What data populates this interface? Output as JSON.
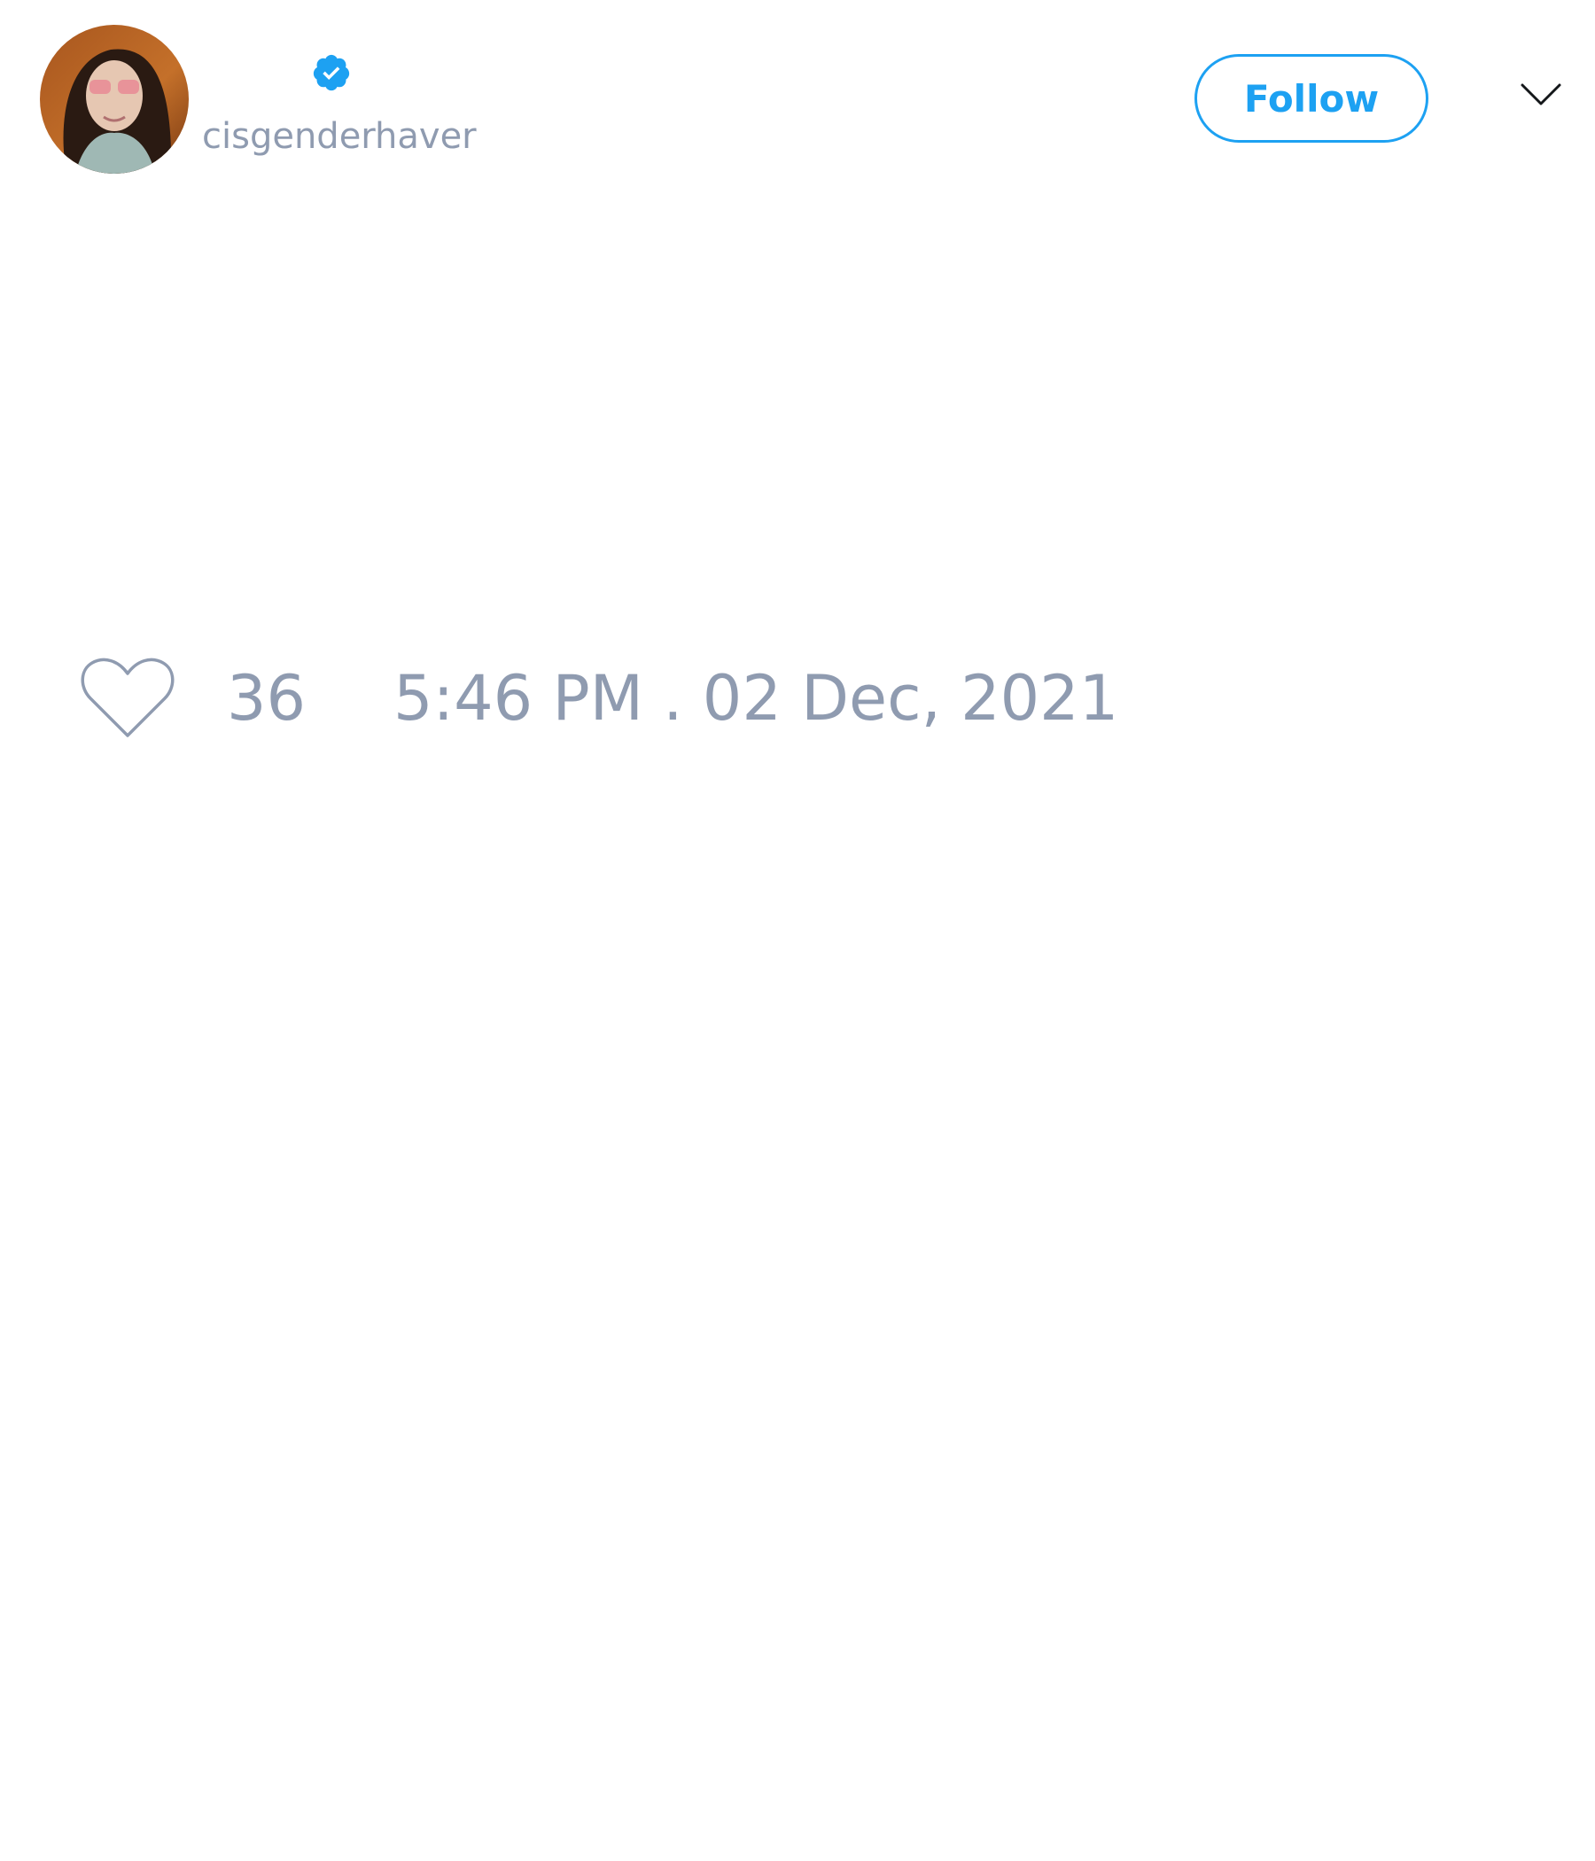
{
  "tweet": {
    "author": {
      "display_name": "",
      "handle": "cisgenderhaver",
      "verified": true,
      "avatar": "profile-photo"
    },
    "follow_button": {
      "label": "Follow"
    },
    "menu_icon": "chevron-down-icon",
    "stats": {
      "like_icon": "heart-outline-icon",
      "like_count": "36",
      "timestamp": "5:46 PM . 02 Dec, 2021"
    }
  },
  "colors": {
    "accent": "#1da1f2",
    "muted_text": "#8f9bb0",
    "background": "#ffffff",
    "icon_dark": "#14171a"
  }
}
